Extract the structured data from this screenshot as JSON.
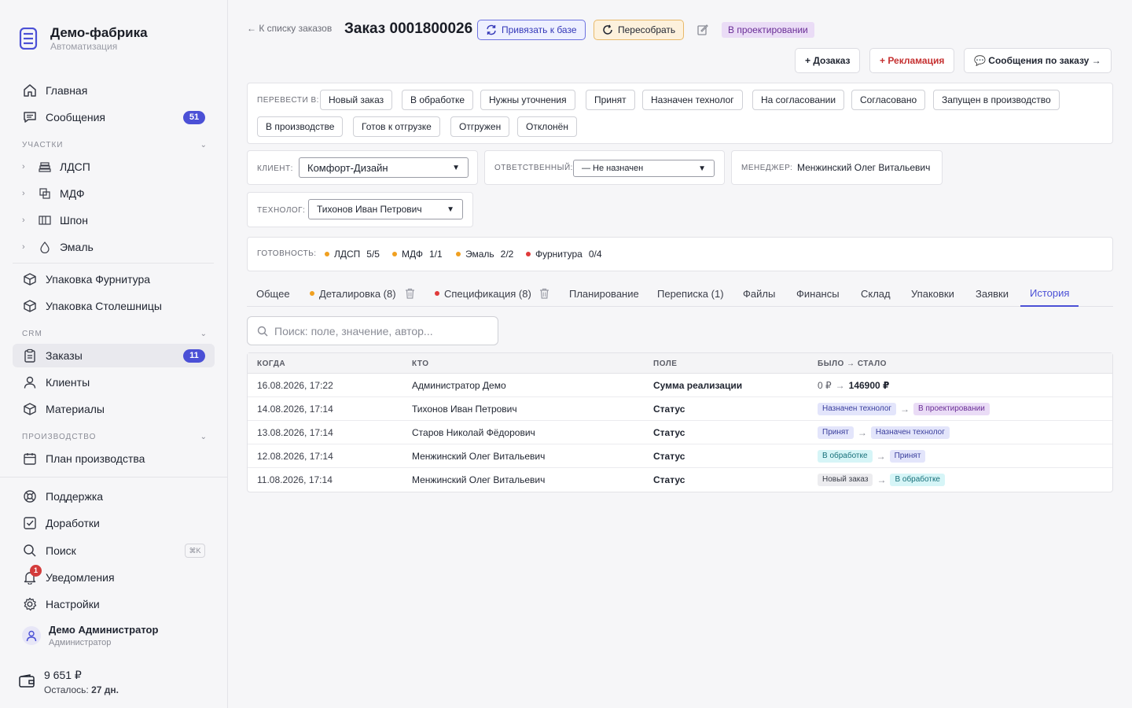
{
  "brand": {
    "name": "Демо-фабрика",
    "sub": "Автоматизация"
  },
  "nav": {
    "home": "Главная",
    "messages": "Сообщения",
    "messages_count": "51",
    "section_areas": "Участки",
    "areas": [
      "ЛДСП",
      "МДФ",
      "Шпон",
      "Эмаль"
    ],
    "pack_hardware": "Упаковка Фурнитура",
    "pack_tops": "Упаковка Столешницы",
    "section_crm": "CRM",
    "orders": "Заказы",
    "orders_count": "11",
    "clients": "Клиенты",
    "materials": "Материалы",
    "section_production": "Производство",
    "production_plan": "План производства",
    "support": "Поддержка",
    "improvements": "Доработки",
    "search": "Поиск",
    "search_kbd": "⌘K",
    "notifications": "Уведомления",
    "notifications_count": "1",
    "settings": "Настройки"
  },
  "user": {
    "name": "Демо Администратор",
    "role": "Администратор"
  },
  "wallet": {
    "amount": "9 651 ₽",
    "remaining_label": "Осталось:",
    "remaining_value": "27 дн."
  },
  "header": {
    "back": "← К списку заказов",
    "title": "Заказ 0001800026",
    "bind_btn": "Привязать к базе",
    "rebuild_btn": "Пересобрать",
    "status": "В проектировании",
    "add_order": "+ Дозаказ",
    "claim": "+ Рекламация",
    "order_messages": "💬 Сообщения по заказу →"
  },
  "transition": {
    "label": "Перевести в:",
    "statuses": [
      "Новый заказ",
      "В обработке",
      "Нужны уточнения",
      "Принят",
      "Назначен технолог",
      "На согласовании",
      "Согласовано",
      "Запущен в производство",
      "В производстве",
      "Готов к отгрузке",
      "Отгружен",
      "Отклонён"
    ]
  },
  "fields": {
    "client_label": "Клиент:",
    "client_value": "Комфорт-Дизайн",
    "responsible_label": "Ответственный:",
    "responsible_value": "— Не назначен",
    "manager_label": "Менеджер:",
    "manager_value": "Менжинский Олег Витальевич",
    "technologist_label": "Технолог:",
    "technologist_value": "Тихонов Иван Петрович"
  },
  "readiness": {
    "label": "Готовность:",
    "items": [
      {
        "name": "ЛДСП",
        "value": "5/5",
        "color": "#f0a020"
      },
      {
        "name": "МДФ",
        "value": "1/1",
        "color": "#f0a020"
      },
      {
        "name": "Эмаль",
        "value": "2/2",
        "color": "#f0a020"
      },
      {
        "name": "Фурнитура",
        "value": "0/4",
        "color": "#e03a3a"
      }
    ]
  },
  "tabs": [
    "Общее",
    "Деталировка (8)",
    "Спецификация (8)",
    "Планирование",
    "Переписка (1)",
    "Файлы",
    "Финансы",
    "Склад",
    "Упаковки",
    "Заявки",
    "История"
  ],
  "search_placeholder": "Поиск: поле, значение, автор...",
  "history": {
    "headers": [
      "Когда",
      "Кто",
      "Поле",
      "Было → Стало"
    ],
    "rows": [
      {
        "when": "16.08.2026, 17:22",
        "who": "Администратор Демо",
        "field": "Сумма реализации",
        "from": "0 ₽",
        "to": "146900 ₽"
      },
      {
        "when": "14.08.2026, 17:14",
        "who": "Тихонов Иван Петрович",
        "field": "Статус",
        "from": "Назначен технолог",
        "to": "В проектировании"
      },
      {
        "when": "13.08.2026, 17:14",
        "who": "Старов Николай Фёдорович",
        "field": "Статус",
        "from": "Принят",
        "to": "Назначен технолог"
      },
      {
        "when": "12.08.2026, 17:14",
        "who": "Менжинский Олег Витальевич",
        "field": "Статус",
        "from": "В обработке",
        "to": "Принят"
      },
      {
        "when": "11.08.2026, 17:14",
        "who": "Менжинский Олег Витальевич",
        "field": "Статус",
        "from": "Новый заказ",
        "to": "В обработке"
      }
    ],
    "arrow": "→"
  }
}
